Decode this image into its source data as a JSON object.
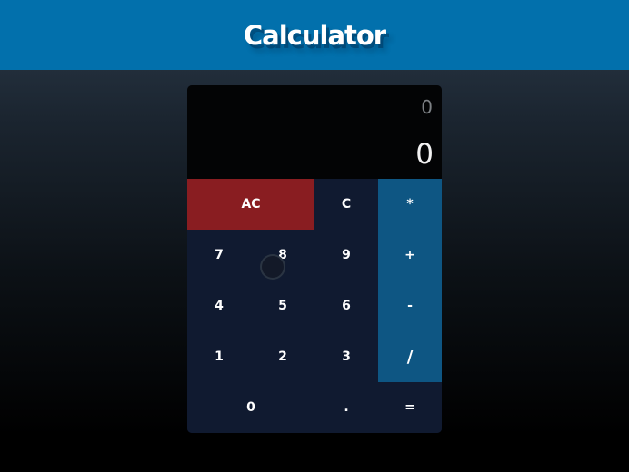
{
  "header": {
    "title": "Calculator"
  },
  "display": {
    "previous_operand": "0",
    "current_operand": "0"
  },
  "buttons": {
    "all_clear": "AC",
    "clear": "C",
    "multiply": "*",
    "seven": "7",
    "eight": "8",
    "nine": "9",
    "add": "+",
    "four": "4",
    "five": "5",
    "six": "6",
    "subtract": "-",
    "one": "1",
    "two": "2",
    "three": "3",
    "divide": "/",
    "zero": "0",
    "decimal": ".",
    "equals": "="
  },
  "colors": {
    "header_bg": "#0270ac",
    "keypad_bg": "#101a30",
    "operator_bg": "#0e5683",
    "clear_bg": "#891d21",
    "display_bg": "#030405"
  }
}
